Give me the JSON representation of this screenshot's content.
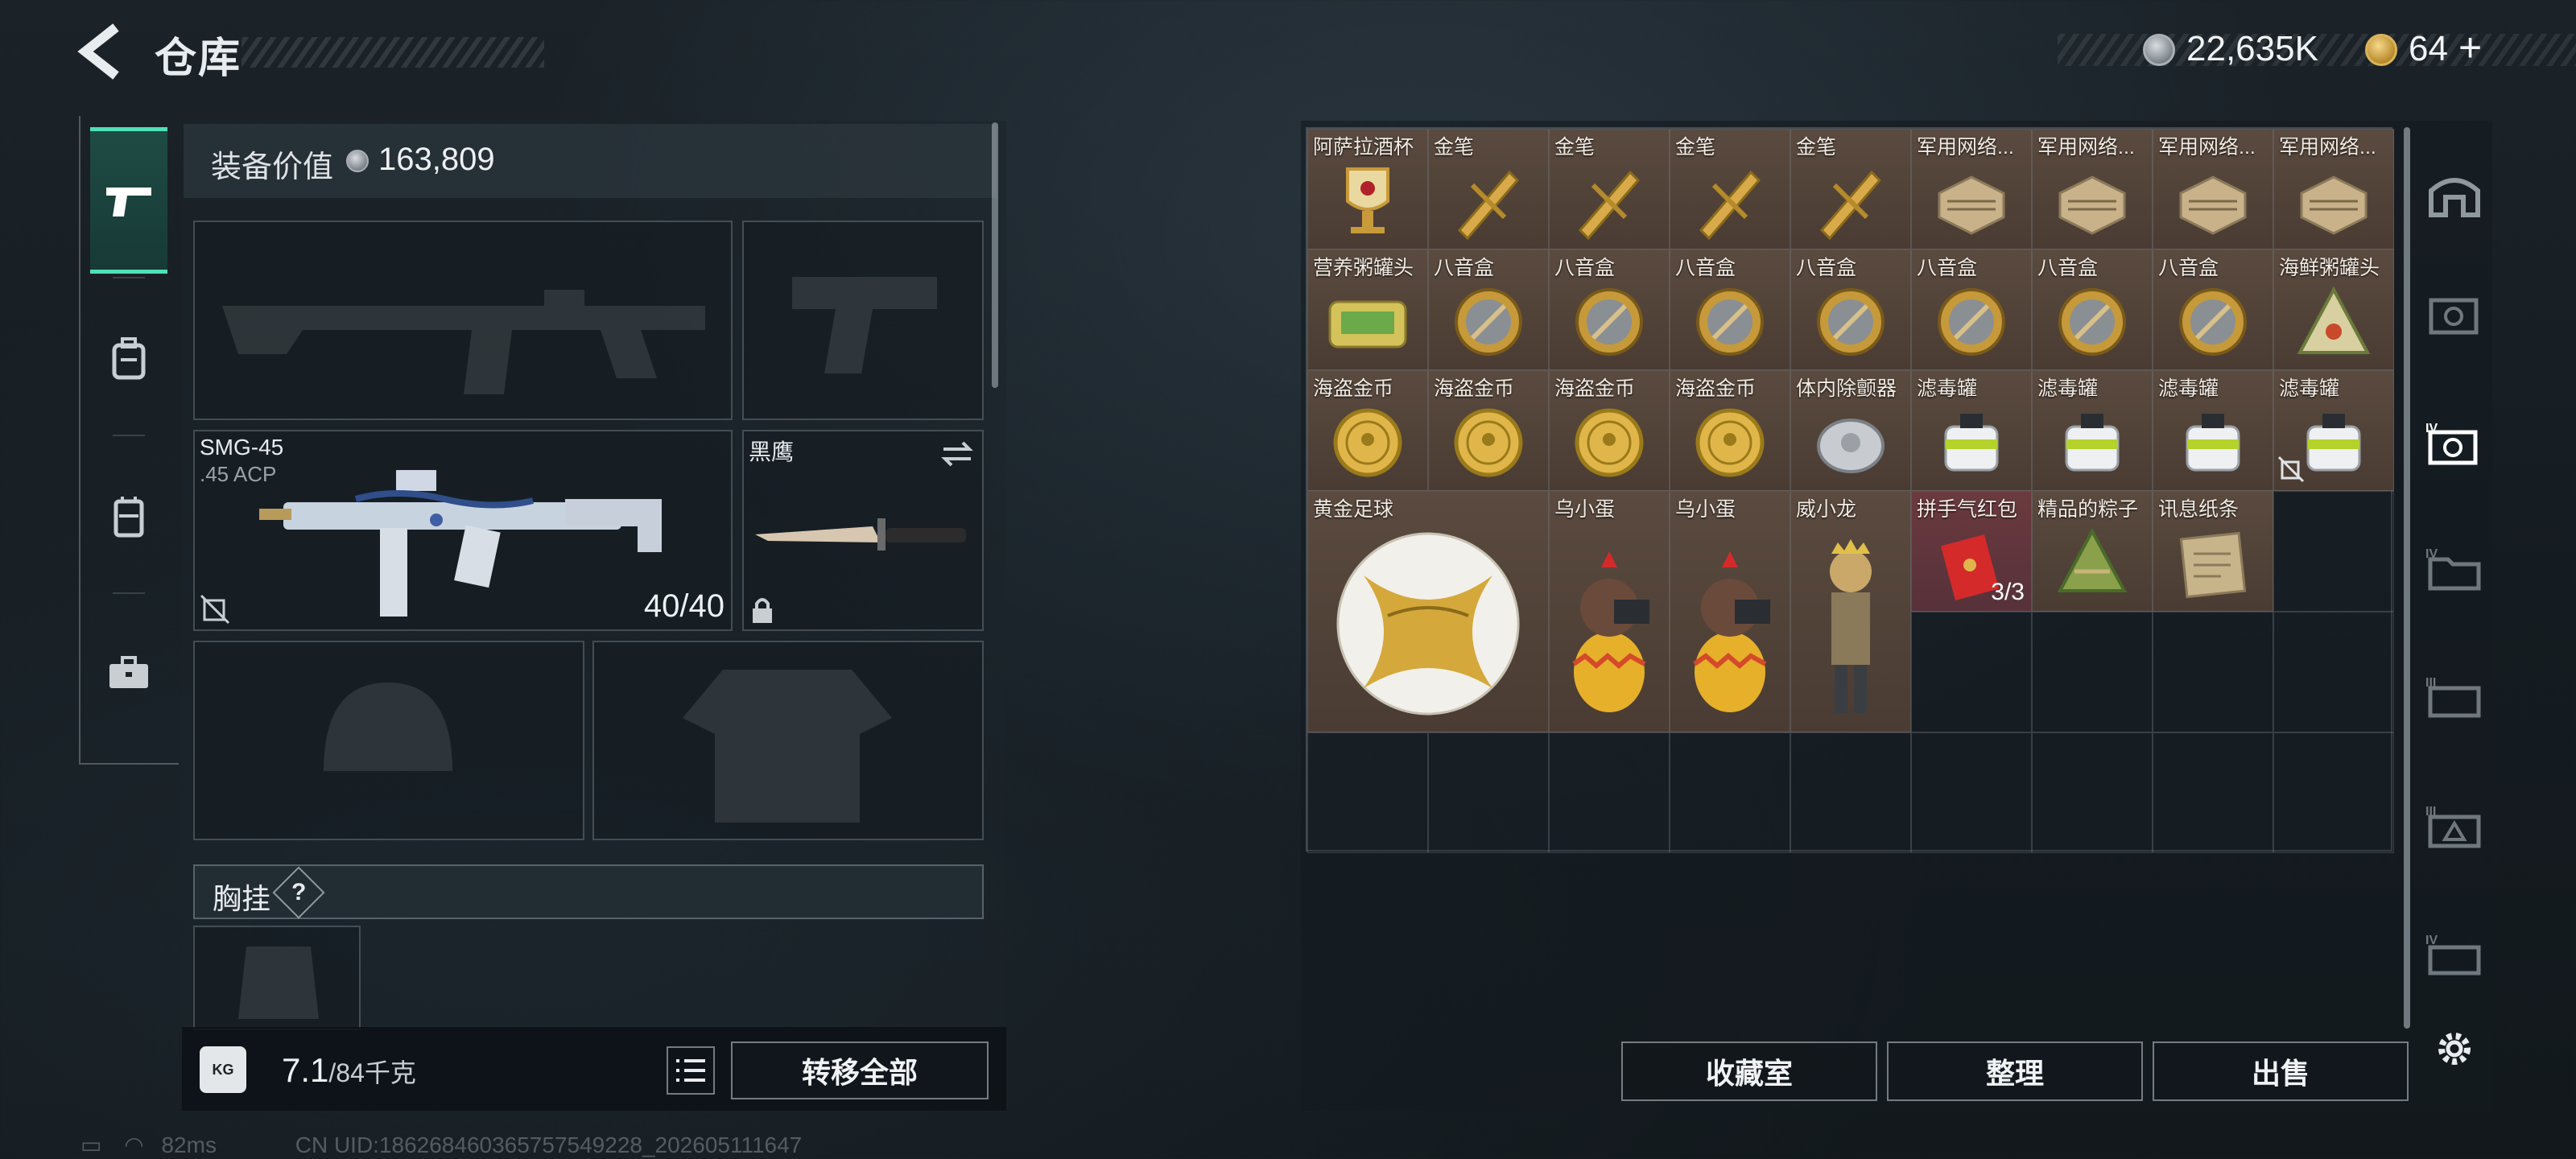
{
  "header": {
    "title": "仓库",
    "currency_silver": "22,635K",
    "currency_gold": "64",
    "add_symbol": "+"
  },
  "loadout": {
    "value_label": "装备价值",
    "value": "163,809",
    "primary_weapon": {
      "name": "SMG-45",
      "caliber": ".45 ACP",
      "ammo": "40/40"
    },
    "melee": {
      "name": "黑鹰"
    },
    "chest_rig_label": "胸挂",
    "chest_rig_help": "?",
    "weight_current": "7.1",
    "weight_max": "/84千克",
    "kg_badge": "KG",
    "transfer_all": "转移全部"
  },
  "storage": {
    "items": [
      {
        "name": "阿萨拉酒杯",
        "icon": "goblet-icon"
      },
      {
        "name": "金笔",
        "icon": "gold-pen-icon"
      },
      {
        "name": "金笔",
        "icon": "gold-pen-icon"
      },
      {
        "name": "金笔",
        "icon": "gold-pen-icon"
      },
      {
        "name": "金笔",
        "icon": "gold-pen-icon"
      },
      {
        "name": "军用网络...",
        "icon": "network-device-icon"
      },
      {
        "name": "军用网络...",
        "icon": "network-device-icon"
      },
      {
        "name": "军用网络...",
        "icon": "network-device-icon"
      },
      {
        "name": "军用网络...",
        "icon": "network-device-icon"
      },
      {
        "name": "营养粥罐头",
        "icon": "tin-can-icon"
      },
      {
        "name": "八音盒",
        "icon": "music-box-icon"
      },
      {
        "name": "八音盒",
        "icon": "music-box-icon"
      },
      {
        "name": "八音盒",
        "icon": "music-box-icon"
      },
      {
        "name": "八音盒",
        "icon": "music-box-icon"
      },
      {
        "name": "八音盒",
        "icon": "music-box-icon"
      },
      {
        "name": "八音盒",
        "icon": "music-box-icon"
      },
      {
        "name": "八音盒",
        "icon": "music-box-icon"
      },
      {
        "name": "海鲜粥罐头",
        "icon": "triangle-can-icon"
      },
      {
        "name": "海盗金币",
        "icon": "gold-coin-icon"
      },
      {
        "name": "海盗金币",
        "icon": "gold-coin-icon"
      },
      {
        "name": "海盗金币",
        "icon": "gold-coin-icon"
      },
      {
        "name": "海盗金币",
        "icon": "gold-coin-icon"
      },
      {
        "name": "体内除颤器",
        "icon": "defibrillator-icon"
      },
      {
        "name": "滤毒罐",
        "icon": "filter-canister-icon"
      },
      {
        "name": "滤毒罐",
        "icon": "filter-canister-icon"
      },
      {
        "name": "滤毒罐",
        "icon": "filter-canister-icon"
      },
      {
        "name": "滤毒罐",
        "icon": "filter-canister-icon"
      }
    ],
    "large_items": [
      {
        "name": "黄金足球",
        "icon": "golden-football-icon"
      },
      {
        "name": "乌小蛋",
        "icon": "egg-figure-icon"
      },
      {
        "name": "乌小蛋",
        "icon": "egg-figure-icon"
      },
      {
        "name": "威小龙",
        "icon": "soldier-figure-icon"
      }
    ],
    "small_row4": [
      {
        "name": "拼手气红包",
        "icon": "red-envelope-icon",
        "count": "3/3"
      },
      {
        "name": "精品的粽子",
        "icon": "zongzi-icon"
      },
      {
        "name": "讯息纸条",
        "icon": "note-paper-icon"
      }
    ],
    "buttons": {
      "collection": "收藏室",
      "sort": "整理",
      "sell": "出售"
    }
  },
  "status": {
    "ping": "82ms",
    "uid": "CN UID:18626846036575754922­8_202605111647"
  }
}
